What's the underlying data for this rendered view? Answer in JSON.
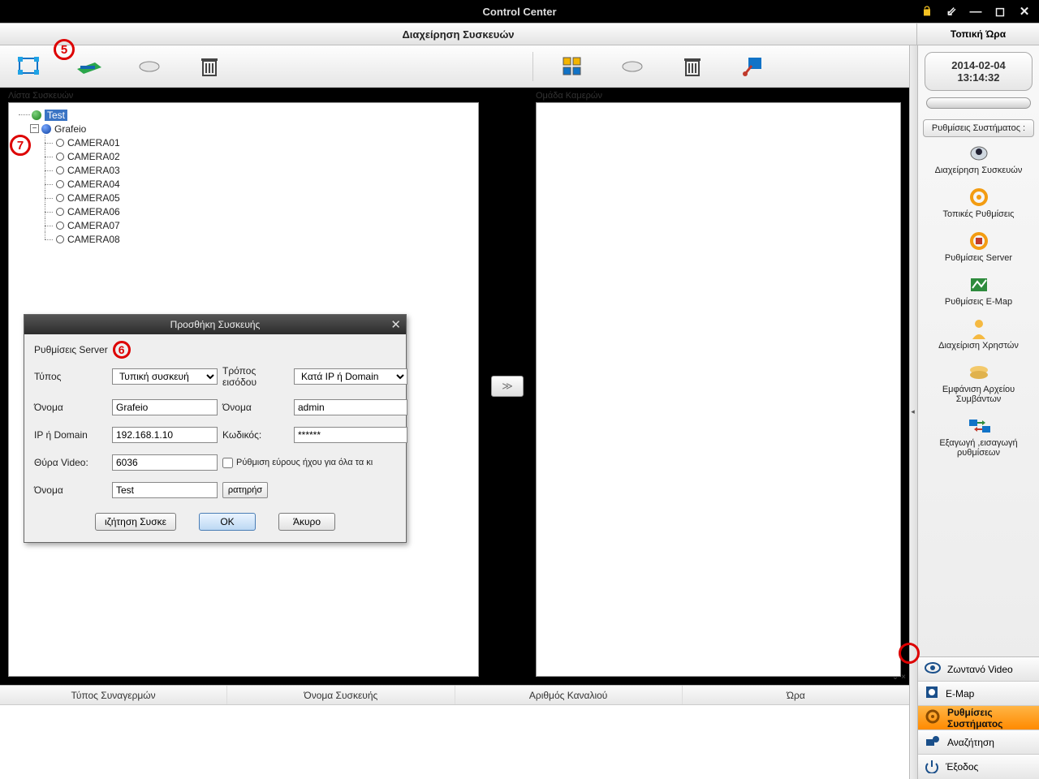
{
  "window": {
    "title": "Control Center"
  },
  "header": {
    "left": "Διαχείρηση Συσκευών",
    "right": "Τοπική Ώρα"
  },
  "clock": {
    "date": "2014-02-04",
    "time": "13:14:32"
  },
  "pane_titles": {
    "devices": "Λίστα Συσκευών",
    "cameras": "Ομάδα Καμερών"
  },
  "tree": {
    "root": "Test",
    "dvr": "Grafeio",
    "cams": [
      "CAMERA01",
      "CAMERA02",
      "CAMERA03",
      "CAMERA04",
      "CAMERA05",
      "CAMERA06",
      "CAMERA07",
      "CAMERA08"
    ]
  },
  "dialog": {
    "title": "Προσθήκη Συσκευής",
    "section": "Ρυθμίσεις Server",
    "labels": {
      "type": "Τύπος",
      "entry": "Τρόπος εισόδου",
      "name": "Όνομα",
      "user": "Όνομα",
      "ip": "IP ή Domain",
      "pass": "Κωδικός:",
      "port": "Θύρα Video:",
      "area": "Όνομα",
      "chk": "Ρύθμιση εύρους ήχου για όλα τα κι"
    },
    "values": {
      "type": "Τυπική συσκευή",
      "entry": "Κατά IP ή Domain",
      "name": "Grafeio",
      "user": "admin",
      "ip": "192.168.1.10",
      "pass": "******",
      "port": "6036",
      "area": "Test",
      "area_btn": "ρατηρήσ"
    },
    "buttons": {
      "search": "ιζήτηση Συσκε",
      "ok": "OK",
      "cancel": "Άκυρο"
    }
  },
  "alarms": {
    "cols": [
      "Τύπος Συναγερμών",
      "Όνομα Συσκευής",
      "Αριθμός Καναλιού",
      "Ώρα"
    ]
  },
  "sidebar": {
    "config_btn": "Ρυθμίσεις Συστήματος :",
    "items": [
      {
        "label": "Διαχείρηση Συσκευών"
      },
      {
        "label": "Τοπικές Ρυθμίσεις"
      },
      {
        "label": "Ρυθμίσεις Server"
      },
      {
        "label": "Ρυθμίσεις E-Map"
      },
      {
        "label": "Διαχείριση Χρηστών"
      },
      {
        "label": "Εμφάνιση Αρχείου Συμβάντων"
      },
      {
        "label": "Εξαγωγή ,εισαγωγή ρυθμίσεων"
      }
    ],
    "bottom": [
      {
        "label": "Ζωντανό Video"
      },
      {
        "label": "E-Map"
      },
      {
        "label": "Ρυθμίσεις Συστήματος"
      },
      {
        "label": "Αναζήτηση"
      },
      {
        "label": "Έξοδος"
      }
    ],
    "active_bottom": 2
  },
  "annotations": {
    "a5": "5",
    "a6": "6",
    "a7": "7"
  }
}
